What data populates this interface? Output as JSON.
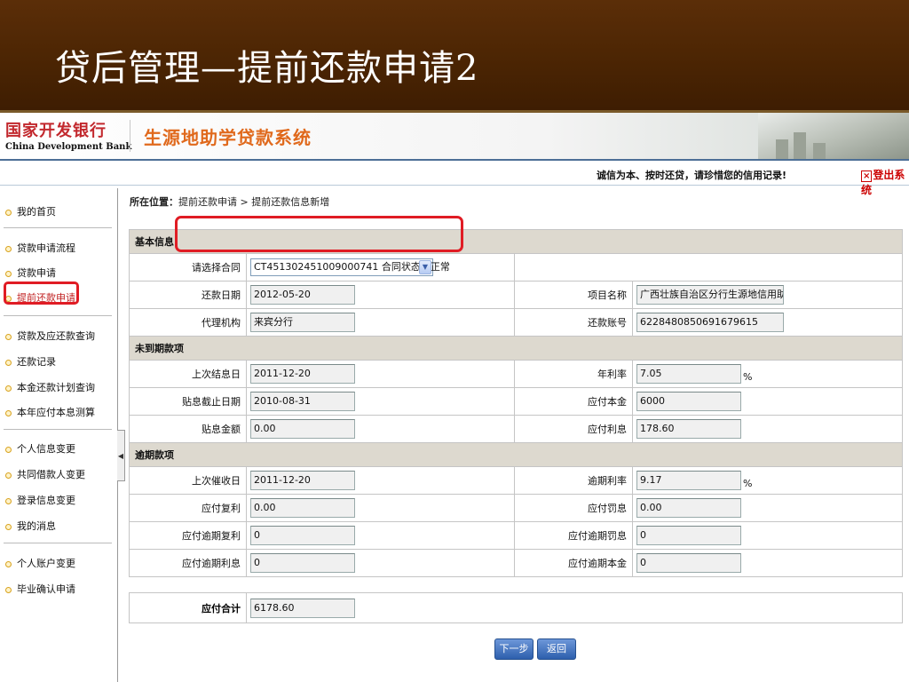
{
  "slide": {
    "title": "贷后管理—提前还款申请2"
  },
  "header": {
    "bank_cn": "国家开发银行",
    "bank_en": "China Development Bank",
    "system_name": "生源地助学贷款系统"
  },
  "notice": {
    "text": "诚信为本、按时还贷，请珍惜您的信用记录!",
    "logout": "登出系统",
    "logout_icon": "×"
  },
  "sidebar": {
    "items": [
      {
        "label": "我的首页"
      },
      {
        "label": "贷款申请流程"
      },
      {
        "label": "贷款申请"
      },
      {
        "label": "提前还款申请"
      },
      {
        "label": "贷款及应还款查询"
      },
      {
        "label": "还款记录"
      },
      {
        "label": "本金还款计划查询"
      },
      {
        "label": "本年应付本息测算"
      },
      {
        "label": "个人信息变更"
      },
      {
        "label": "共同借款人变更"
      },
      {
        "label": "登录信息变更"
      },
      {
        "label": "我的消息"
      },
      {
        "label": "个人账户变更"
      },
      {
        "label": "毕业确认申请"
      }
    ]
  },
  "breadcrumb": {
    "prefix": "所在位置：",
    "path": "提前还款申请 > 提前还款信息新增"
  },
  "form": {
    "basic": {
      "title": "基本信息",
      "contract_label": "请选择合同",
      "contract_value": "CT451302451009000741  合同状态：正常",
      "repay_date_label": "还款日期",
      "repay_date": "2012-05-20",
      "project_label": "项目名称",
      "project": "广西壮族自治区分行生源地信用助学贷款",
      "agency_label": "代理机构",
      "agency": "来宾分行",
      "account_label": "还款账号",
      "account": "6228480850691679615"
    },
    "undue": {
      "title": "未到期款项",
      "last_settle_label": "上次结息日",
      "last_settle": "2011-12-20",
      "rate_label": "年利率",
      "rate": "7.05",
      "rate_unit": "%",
      "subsidy_end_label": "贴息截止日期",
      "subsidy_end": "2010-08-31",
      "principal_label": "应付本金",
      "principal": "6000",
      "subsidy_amount_label": "贴息金额",
      "subsidy_amount": "0.00",
      "interest_label": "应付利息",
      "interest": "178.60"
    },
    "overdue": {
      "title": "逾期款项",
      "last_collect_label": "上次催收日",
      "last_collect": "2011-12-20",
      "od_rate_label": "逾期利率",
      "od_rate": "9.17",
      "od_rate_unit": "%",
      "compound_label": "应付复利",
      "compound": "0.00",
      "penalty_label": "应付罚息",
      "penalty": "0.00",
      "od_compound_label": "应付逾期复利",
      "od_compound": "0",
      "od_penalty_label": "应付逾期罚息",
      "od_penalty": "0",
      "od_interest_label": "应付逾期利息",
      "od_interest": "0",
      "od_principal_label": "应付逾期本金",
      "od_principal": "0"
    },
    "total_label": "应付合计",
    "total": "6178.60"
  },
  "buttons": {
    "next": "下一步",
    "back": "返回"
  },
  "colors": {
    "title_band": "#4a2403",
    "highlight": "#e01c24",
    "section_bg": "#ddd9cf",
    "accent_orange": "#e0691c",
    "bank_red": "#c2282d"
  }
}
